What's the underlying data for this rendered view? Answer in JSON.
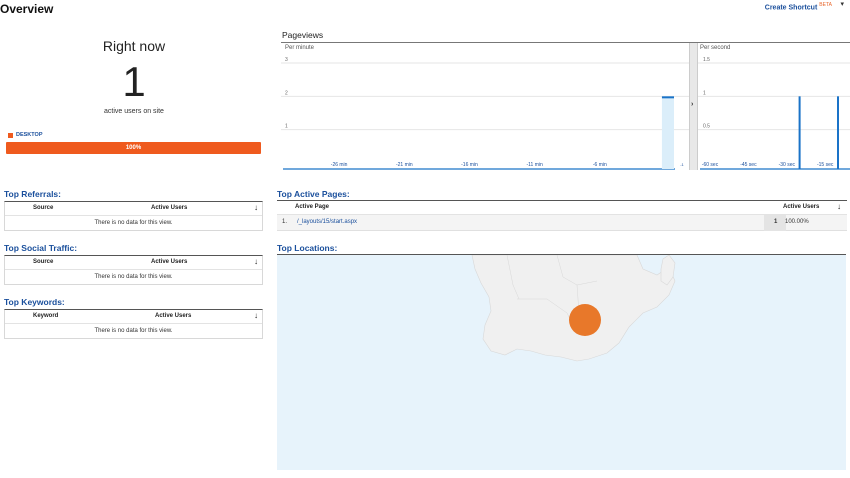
{
  "header": {
    "title": "Overview",
    "create_shortcut": "Create Shortcut",
    "beta": "BETA"
  },
  "right_now": {
    "title": "Right now",
    "count": "1",
    "label": "active users on site",
    "device_legend": "DESKTOP",
    "device_percent": "100%",
    "device_fraction": 1.0,
    "device_color": "#ef5a1e"
  },
  "pageviews": {
    "title": "Pageviews",
    "per_minute": "Per minute",
    "per_second": "Per second",
    "minute_yticks": [
      "3",
      "2",
      "1"
    ],
    "minute_xticks": [
      "-26 min",
      "-21 min",
      "-16 min",
      "-11 min",
      "-6 min"
    ],
    "minute_last_tick": "-1",
    "second_yticks": [
      "1.5",
      "1",
      "0.5"
    ],
    "second_xticks": [
      "-60 sec",
      "-45 sec",
      "-30 sec",
      "-15 sec"
    ]
  },
  "chart_data": [
    {
      "type": "bar",
      "title": "Per minute",
      "x": [
        -30,
        -29,
        -28,
        -27,
        -26,
        -25,
        -24,
        -23,
        -22,
        -21,
        -20,
        -19,
        -18,
        -17,
        -16,
        -15,
        -14,
        -13,
        -12,
        -11,
        -10,
        -9,
        -8,
        -7,
        -6,
        -5,
        -4,
        -3,
        -2,
        -1
      ],
      "values": [
        0,
        0,
        0,
        0,
        0,
        0,
        0,
        0,
        0,
        0,
        0,
        0,
        0,
        0,
        0,
        0,
        0,
        0,
        0,
        0,
        0,
        0,
        0,
        0,
        0,
        0,
        0,
        0,
        0,
        2
      ],
      "ylim": [
        0,
        3
      ],
      "xlabel": "",
      "ylabel": "",
      "grid": true
    },
    {
      "type": "bar",
      "title": "Per second",
      "x": [
        -60,
        -45,
        -30,
        -25,
        -15,
        -10
      ],
      "values": [
        0,
        0,
        0,
        1,
        0,
        1
      ],
      "ylim": [
        0,
        1.5
      ],
      "xlabel": "",
      "ylabel": "",
      "grid": true
    }
  ],
  "top_referrals": {
    "title": "Top Referrals:",
    "col1": "Source",
    "col2": "Active Users",
    "empty": "There is no data for this view."
  },
  "top_social": {
    "title": "Top Social Traffic:",
    "col1": "Source",
    "col2": "Active Users",
    "empty": "There is no data for this view."
  },
  "top_keywords": {
    "title": "Top Keywords:",
    "col1": "Keyword",
    "col2": "Active Users",
    "empty": "There is no data for this view."
  },
  "top_pages": {
    "title": "Top Active Pages:",
    "col_page": "Active Page",
    "col_users": "Active Users",
    "rows": [
      {
        "index": "1.",
        "page": "/_layouts/15/start.aspx",
        "users": "1",
        "percent": "100.00%"
      }
    ]
  },
  "top_locations": {
    "title": "Top Locations:",
    "land_color": "#f0f0f0",
    "water_color": "#e7f3fb",
    "marker_color": "#e8782a"
  }
}
